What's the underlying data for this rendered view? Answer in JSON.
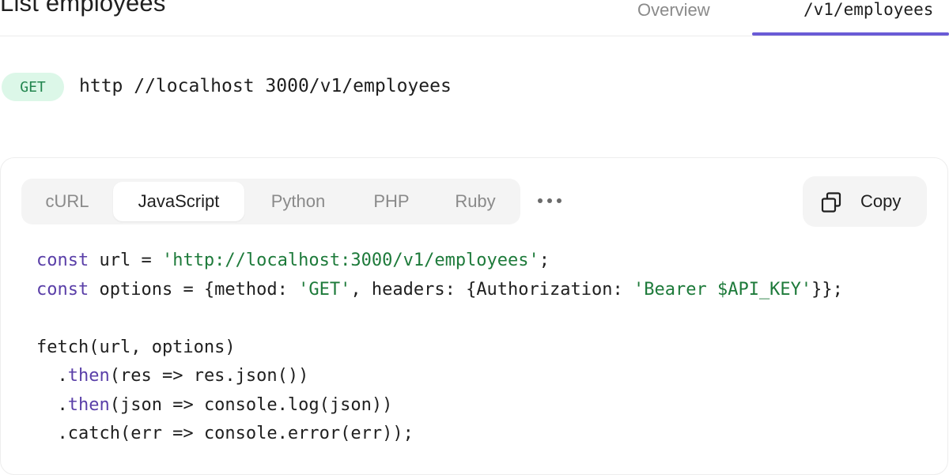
{
  "header": {
    "title": "List employees",
    "tabs": [
      {
        "label": "Overview",
        "active": false
      },
      {
        "label": "/v1/employees",
        "active": true
      }
    ],
    "accent_color": "#6a5bd6"
  },
  "request": {
    "method": "GET",
    "url": "http //localhost 3000/v1/employees",
    "method_color": "#23864f",
    "method_bg": "#dcf7e8"
  },
  "code_panel": {
    "languages": [
      "cURL",
      "JavaScript",
      "Python",
      "PHP",
      "Ruby"
    ],
    "active_language": "JavaScript",
    "more_icon": "more-horizontal-icon",
    "copy_icon": "copy-icon",
    "copy_label": "Copy",
    "code_lines": [
      [
        {
          "t": "const",
          "c": "kw"
        },
        {
          "t": " url = "
        },
        {
          "t": "'http://localhost:3000/v1/employees'",
          "c": "str"
        },
        {
          "t": ";"
        }
      ],
      [
        {
          "t": "const",
          "c": "kw"
        },
        {
          "t": " options = {method: "
        },
        {
          "t": "'GET'",
          "c": "str"
        },
        {
          "t": ", headers: {Authorization: "
        },
        {
          "t": "'Bearer $API_KEY'",
          "c": "str"
        },
        {
          "t": "}};"
        }
      ],
      [],
      [
        {
          "t": "fetch(url, options)"
        }
      ],
      [
        {
          "t": "  ."
        },
        {
          "t": "then",
          "c": "kw"
        },
        {
          "t": "(res => res.json())"
        }
      ],
      [
        {
          "t": "  ."
        },
        {
          "t": "then",
          "c": "kw"
        },
        {
          "t": "(json => console.log(json))"
        }
      ],
      [
        {
          "t": "  .catch(err => console.error(err));"
        }
      ]
    ],
    "syntax_colors": {
      "keyword": "#5a3fa8",
      "string": "#1d7a3a"
    }
  }
}
